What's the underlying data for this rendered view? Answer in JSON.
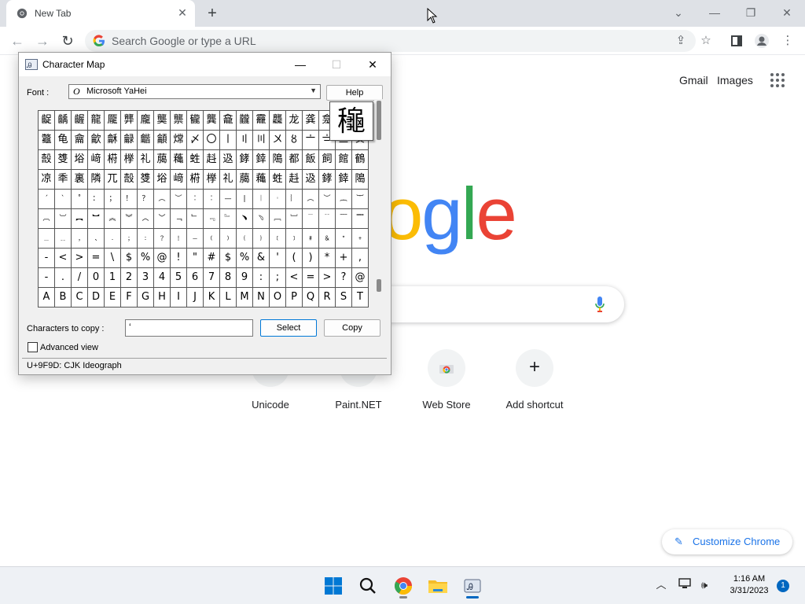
{
  "chrome": {
    "tab_title": "New Tab",
    "tab_close": "✕",
    "new_tab": "+",
    "omnibox_placeholder": "Search Google or type a URL",
    "window_controls": [
      "⌄",
      "—",
      "❐",
      "✕"
    ]
  },
  "ntp": {
    "gmail": "Gmail",
    "images": "Images",
    "logo_letters": [
      {
        "ch": "o",
        "color": "#fbbc05"
      },
      {
        "ch": "g",
        "color": "#4285f4"
      },
      {
        "ch": "l",
        "color": "#34a853"
      },
      {
        "ch": "e",
        "color": "#ea4335"
      }
    ],
    "shortcuts": [
      {
        "label": "Unicode"
      },
      {
        "label": "Paint.NET"
      },
      {
        "label": "Web Store"
      },
      {
        "label": "Add shortcut",
        "icon": "+"
      }
    ],
    "customize": "Customize Chrome"
  },
  "charmap": {
    "title": "Character Map",
    "font_label": "Font :",
    "font_value": "Microsoft YaHei",
    "help": "Help",
    "preview_char": "龝",
    "copy_label": "Characters to copy :",
    "copy_value": "ʻ",
    "select": "Select",
    "copy": "Copy",
    "advanced": "Advanced view",
    "status": "U+9F9D: CJK Ideograph",
    "rows": [
      [
        "齪",
        "齲",
        "齷",
        "龍",
        "龎",
        "龏",
        "龐",
        "龑",
        "龒",
        "龓",
        "龔",
        "龕",
        "龖",
        "龗",
        "龘",
        "龙",
        "龚",
        "龛",
        "龜",
        "龝"
      ],
      [
        "龞",
        "龟",
        "龠",
        "龡",
        "龢",
        "龣",
        "龤",
        "龥",
        "龦",
        "〆",
        "〇",
        "〡",
        "〢",
        "〣",
        "〤",
        "⾧",
        "⾨",
        "⾩",
        "⾪",
        "⾫"
      ],
      [
        "兀",
        "嗀",
        "﨎",
        "﨏",
        "﨑",
        "﨓",
        "﨔",
        "礼",
        "﨟",
        "蘒",
        "﨡",
        "﨣",
        "﨤",
        "﨧",
        "﨨",
        "﨩",
        "都",
        "飯",
        "飼",
        "館"
      ],
      [
        "凉",
        "秊",
        "裏",
        "隣",
        "兀",
        "嗀",
        "﨎",
        "﨏",
        "﨑",
        "﨓",
        "﨔",
        "礼",
        "﨟",
        "蘒",
        "﨡",
        "﨣",
        "﨤",
        "﨧",
        "﨨",
        "﨩"
      ],
      [
        "ʹ",
        "ʻ",
        "˚",
        "ː",
        "ˑ",
        "!",
        "?",
        "︵",
        "︶",
        "︰",
        "︰",
        "—",
        "|",
        "︱",
        "︲",
        "︴",
        "︵",
        "︶",
        "︷",
        "︸"
      ],
      [
        "︹",
        "︺",
        "︻",
        "︼",
        "︽",
        "︾",
        "︿",
        "﹀",
        "﹁",
        "﹂",
        "﹃",
        "﹄",
        "﹅",
        "﹆",
        "﹇",
        "﹈",
        "﹉",
        "﹊",
        "﹋",
        "﹌"
      ],
      [
        "﹍",
        "﹎",
        "﹏",
        "﹐",
        "﹑",
        "﹒",
        "﹔",
        "﹕",
        "﹖",
        "﹗",
        "﹘",
        "﹙",
        "﹚",
        "﹛",
        "﹜",
        "﹝",
        "﹞",
        "﹟",
        "﹠",
        "﹡"
      ],
      [
        "﹢",
        "﹣",
        "﹤",
        "﹥",
        "﹦",
        "﹨",
        "﹩",
        "﹪",
        "﹫",
        "！",
        "＂",
        "＃",
        "＄",
        "％",
        "＆",
        "＇",
        "（",
        "）",
        "＊",
        "＋"
      ],
      [
        "，",
        "－",
        "．",
        "／",
        "０",
        "１",
        "２",
        "３",
        "４",
        "５",
        "６",
        "７",
        "８",
        "９",
        "：",
        "；",
        "＜",
        "＝",
        "＞",
        "？"
      ],
      [
        "＠",
        "Ａ",
        "Ｂ",
        "Ｃ",
        "Ｄ",
        "Ｅ",
        "Ｆ",
        "Ｇ",
        "Ｈ",
        "Ｉ",
        "Ｊ",
        "Ｋ",
        "Ｌ",
        "Ｍ",
        "Ｎ",
        "Ｏ",
        "Ｐ",
        "Ｑ",
        "Ｒ",
        "Ｓ"
      ]
    ],
    "display_rows": [
      [
        "齪",
        "齲",
        "齷",
        "龍",
        "龎",
        "龏",
        "龐",
        "龑",
        "龒",
        "龓",
        "龔",
        "龕",
        "龖",
        "龗",
        "龘",
        "龙",
        "龚",
        "龛",
        "龜",
        "龝"
      ],
      [
        "龞",
        "龟",
        "龠",
        "龡",
        "龢",
        "龣",
        "龤",
        "龥",
        "龦",
        "〆",
        "〇",
        "〡",
        "〢",
        "〣",
        "〤",
        "〥",
        "〦",
        "〧",
        "〨",
        "〩"
      ],
      [
        "嗀",
        "﨎",
        "﨏",
        "﨑",
        "﨓",
        "﨔",
        "礼",
        "﨟",
        "蘒",
        "﨡",
        "﨣",
        "﨤",
        "﨧",
        "﨨",
        "﨩",
        "都",
        "飯",
        "飼",
        "館",
        "鶴"
      ],
      [
        "凉",
        "秊",
        "裏",
        "隣",
        "兀",
        "嗀",
        "﨎",
        "﨏",
        "﨑",
        "﨓",
        "﨔",
        "礼",
        "﨟",
        "蘒",
        "﨡",
        "﨣",
        "﨤",
        "﨧",
        "﨨",
        "﨩"
      ],
      [
        "ˊ",
        "ˋ",
        "˚",
        "：",
        "；",
        "！",
        "？",
        "︵",
        "︶",
        "︰",
        "︰",
        "—",
        "|",
        "︱",
        "︲",
        "︴",
        "︵",
        "︶",
        "︷",
        "︸"
      ],
      [
        "︹",
        "︺",
        "︻",
        "︼",
        "︽",
        "︾",
        "︿",
        "﹀",
        "﹁",
        "﹂",
        "﹃",
        "﹄",
        "﹅",
        "﹆",
        "﹇",
        "﹈",
        "﹉",
        "﹊",
        "﹋",
        "﹌"
      ],
      [
        "﹍",
        "﹎",
        "﹐",
        "﹑",
        "﹒",
        "﹔",
        "﹕",
        "﹖",
        "﹗",
        "﹘",
        "﹙",
        "﹚",
        "﹛",
        "﹜",
        "﹝",
        "﹞",
        "﹟",
        "﹠",
        "﹡",
        "﹢"
      ],
      [
        "-",
        "<",
        ">",
        "=",
        "\\",
        "$",
        "%",
        "@",
        "!",
        "\"",
        "#",
        "$",
        "%",
        "&",
        "'",
        "(",
        ")",
        "*",
        "+",
        ","
      ],
      [
        "-",
        ".",
        "/",
        "0",
        "1",
        "2",
        "3",
        "4",
        "5",
        "6",
        "7",
        "8",
        "9",
        ":",
        ";",
        "<",
        "=",
        ">",
        "?",
        "@"
      ],
      [
        "A",
        "B",
        "C",
        "D",
        "E",
        "F",
        "G",
        "H",
        "I",
        "J",
        "K",
        "L",
        "M",
        "N",
        "O",
        "P",
        "Q",
        "R",
        "S",
        "T"
      ]
    ]
  },
  "taskbar": {
    "time": "1:16 AM",
    "date": "3/31/2023",
    "badge": "1"
  }
}
